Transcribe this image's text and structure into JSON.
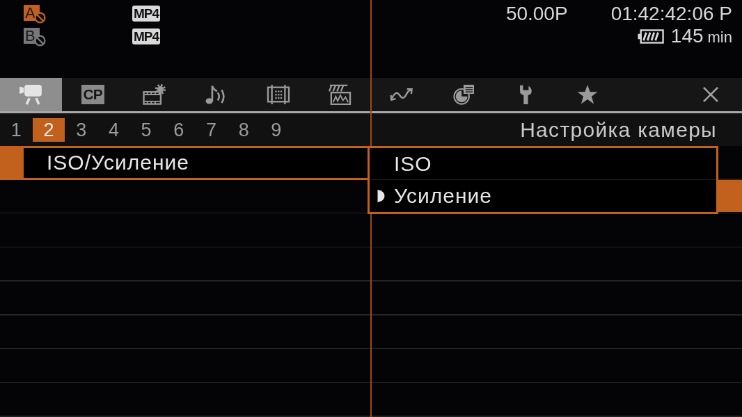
{
  "status": {
    "slots": [
      {
        "label": "A",
        "selected": true,
        "format": "MP4"
      },
      {
        "label": "B",
        "selected": false,
        "format": "MP4"
      }
    ],
    "frame_rate": "50.00P",
    "timecode": "01:42:42:06 P",
    "remaining": "145",
    "remaining_unit": "min"
  },
  "tabs": [
    {
      "kind": "camera",
      "selected": true
    },
    {
      "kind": "custom_picture",
      "label": "CP",
      "selected": false
    },
    {
      "kind": "film_gear",
      "selected": false
    },
    {
      "kind": "audio",
      "selected": false
    },
    {
      "kind": "frame",
      "selected": false
    },
    {
      "kind": "waveform",
      "selected": false
    },
    {
      "kind": "assign",
      "selected": false
    },
    {
      "kind": "media",
      "selected": false
    },
    {
      "kind": "wrench",
      "selected": false
    },
    {
      "kind": "star",
      "selected": false
    }
  ],
  "pages": [
    {
      "label": "1",
      "selected": false
    },
    {
      "label": "2",
      "selected": true
    },
    {
      "label": "3",
      "selected": false
    },
    {
      "label": "4",
      "selected": false
    },
    {
      "label": "5",
      "selected": false
    },
    {
      "label": "6",
      "selected": false
    },
    {
      "label": "7",
      "selected": false
    },
    {
      "label": "8",
      "selected": false
    },
    {
      "label": "9",
      "selected": false
    }
  ],
  "page_title": "Настройка камеры",
  "menu": {
    "items": [
      {
        "label": "ISO/Усиление",
        "selected": true,
        "submenu": [
          {
            "label": "ISO",
            "selected": false,
            "current": false
          },
          {
            "label": "Усиление",
            "selected": true,
            "current": true
          }
        ]
      }
    ]
  }
}
